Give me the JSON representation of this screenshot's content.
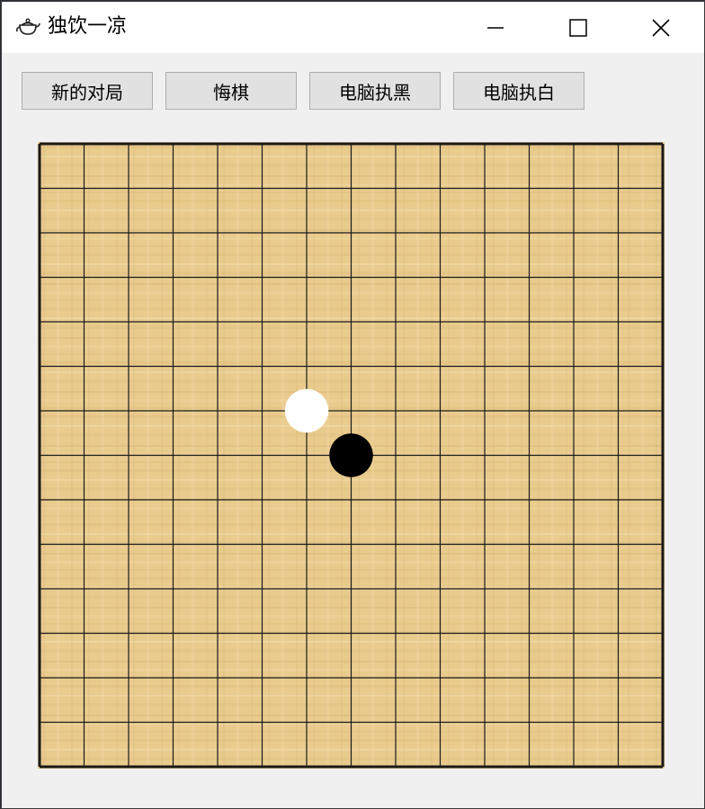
{
  "window": {
    "title": "独饮一凉",
    "icon": "teapot-icon",
    "controls": [
      "minimize-icon",
      "maximize-icon",
      "close-icon"
    ]
  },
  "toolbar": {
    "new_game_label": "新的对局",
    "undo_label": "悔棋",
    "computer_black_label": "电脑执黑",
    "computer_white_label": "电脑执白"
  },
  "board": {
    "size": 15,
    "wood_color": "#e8c98a",
    "line_color": "#1a1a1a",
    "stones": [
      {
        "color": "white",
        "col": 6,
        "row": 6
      },
      {
        "color": "black",
        "col": 7,
        "row": 7
      }
    ]
  }
}
